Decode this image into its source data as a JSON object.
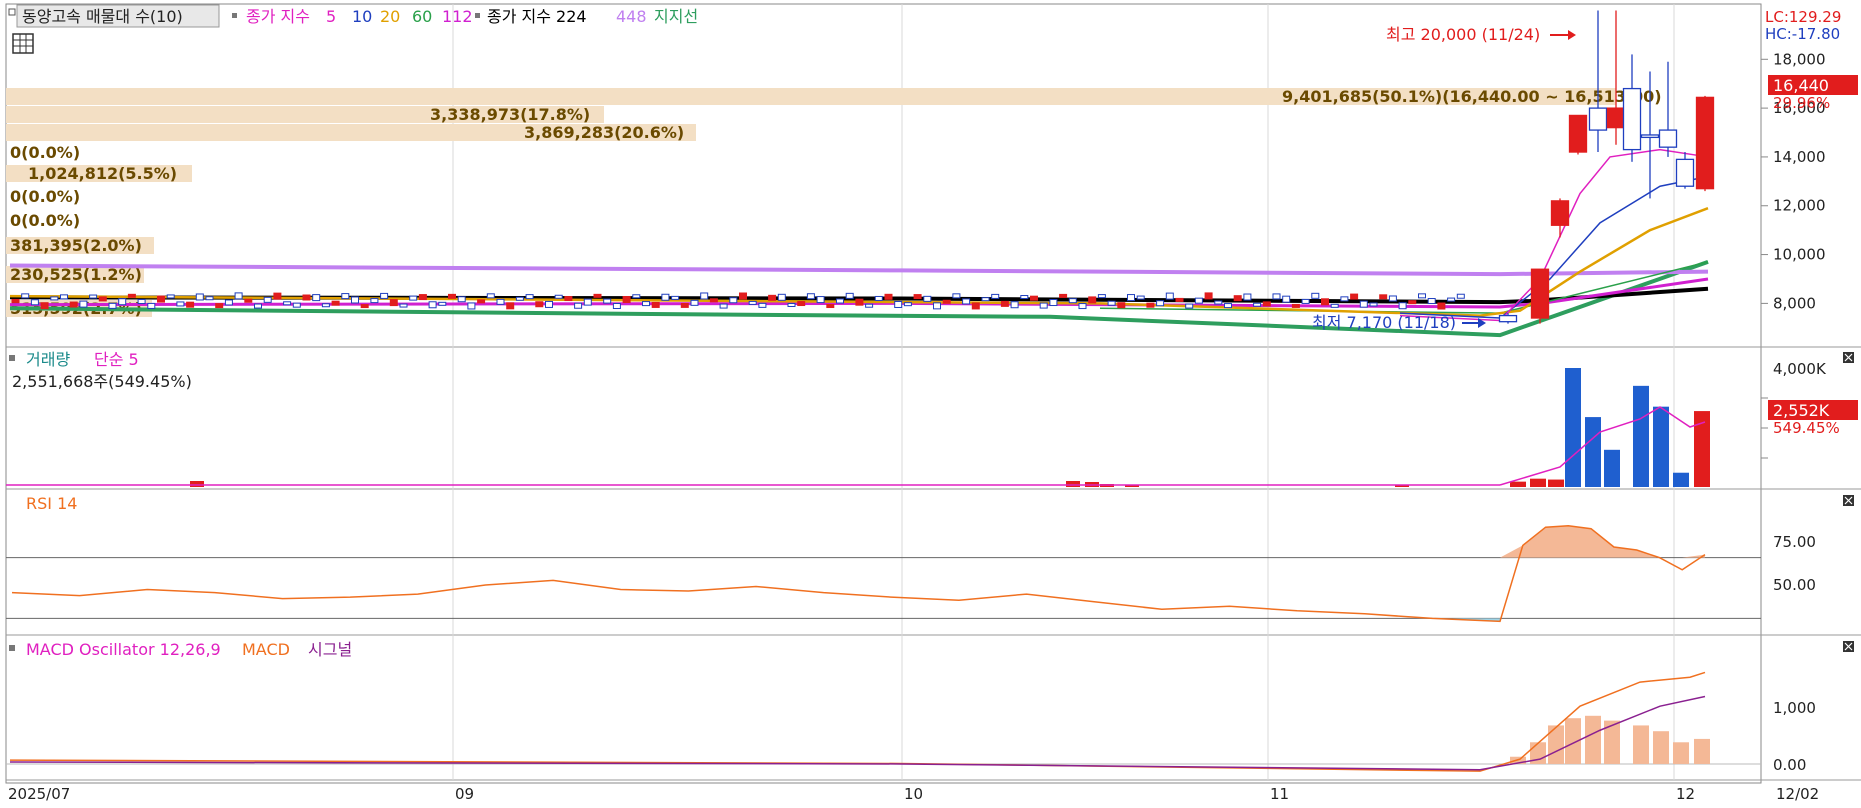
{
  "main_panel": {
    "legend": {
      "title": "동양고속 매물대 수(10)",
      "ma_label": "종가 지수",
      "ma_periods": [
        "5",
        "10",
        "20",
        "60",
        "112"
      ],
      "ma_colors": [
        "#e020c0",
        "#1f3fbf",
        "#e0a000",
        "#2aa04a",
        "#d020d0"
      ],
      "ma2_label": "종가 지수 224",
      "ma2_period2": "448",
      "ma2_colors": [
        "#000000",
        "#c080f0"
      ],
      "support_label": "지지선",
      "support_color": "#2e9e5e"
    },
    "lc": "LC:129.29",
    "hc": "HC:-17.80",
    "price_box": "16,440",
    "price_pct": "29.96%",
    "high_annotation": "최고 20,000 (11/24)",
    "low_annotation": "최저 7,170 (11/18)",
    "volume_profile_labels": [
      "9,401,685(50.1%)(16,440.00 ~ 16,513.00)",
      "3,338,973(17.8%)",
      "3,869,283(20.6%)",
      "0(0.0%)",
      "1,024,812(5.5%)",
      "0(0.0%)",
      "0(0.0%)",
      "381,395(2.0%)",
      "230,525(1.2%)",
      "515,592(2.7%)"
    ],
    "yticks": [
      "18,000",
      "16,000",
      "14,000",
      "12,000",
      "10,000",
      "8,000"
    ]
  },
  "volume_panel": {
    "legend_a": "거래량",
    "legend_b": "단순 5",
    "info": "2,551,668주(549.45%)",
    "ytick": "4,000K",
    "value_box": "2,552K",
    "value_pct": "549.45%"
  },
  "rsi_panel": {
    "legend": "RSI 14",
    "yticks": [
      "75.00",
      "50.00"
    ]
  },
  "macd_panel": {
    "legend_a": "MACD Oscillator 12,26,9",
    "legend_b": "MACD",
    "legend_c": "시그널",
    "yticks": [
      "1,000",
      "0.00"
    ]
  },
  "x_axis": {
    "labels": [
      "2025/07",
      "09",
      "10",
      "11",
      "12"
    ],
    "current_date": "12/02"
  },
  "chart_data": [
    {
      "type": "candlestick",
      "title": "동양고속",
      "ylim": [
        6500,
        19200
      ],
      "candles": [
        {
          "date": "2025/11/17",
          "open": 7500,
          "close": 7250,
          "high": 7600,
          "low": 7170
        },
        {
          "date": "2025/11/18",
          "open": 7400,
          "close": 9400,
          "high": 9400,
          "low": 7170
        },
        {
          "date": "2025/11/19",
          "open": 11200,
          "close": 12200,
          "high": 12300,
          "low": 10700
        },
        {
          "date": "2025/11/20",
          "open": 14200,
          "close": 15700,
          "high": 15700,
          "low": 14100
        },
        {
          "date": "2025/11/21",
          "open": 16000,
          "close": 15100,
          "high": 20000,
          "low": 14200
        },
        {
          "date": "2025/11/24",
          "open": 15200,
          "close": 16000,
          "high": 20000,
          "low": 14500
        },
        {
          "date": "2025/11/25",
          "open": 16800,
          "close": 14300,
          "high": 18200,
          "low": 13800
        },
        {
          "date": "2025/11/26",
          "open": 14900,
          "close": 14800,
          "high": 17500,
          "low": 12300
        },
        {
          "date": "2025/11/27",
          "open": 15100,
          "close": 14400,
          "high": 17900,
          "low": 14000
        },
        {
          "date": "2025/11/28",
          "open": 13900,
          "close": 12800,
          "high": 14200,
          "low": 12700
        },
        {
          "date": "2025/12/02",
          "open": 12700,
          "close": 16440,
          "high": 16500,
          "low": 12600
        }
      ],
      "base_range": [
        7800,
        8400
      ],
      "moving_averages": [
        {
          "name": "5",
          "end": 14000
        },
        {
          "name": "10",
          "end": 13200
        },
        {
          "name": "20",
          "end": 11900
        },
        {
          "name": "60",
          "end": 9700
        },
        {
          "name": "112",
          "end": 9000
        },
        {
          "name": "224",
          "end": 8600
        },
        {
          "name": "448",
          "end": 9300
        }
      ]
    },
    {
      "type": "bar",
      "title": "거래량",
      "ylim": [
        0,
        4000
      ],
      "unit": "K",
      "values": [
        180,
        280,
        250,
        4000,
        2350,
        1250,
        3400,
        2700,
        480,
        2552
      ],
      "up": [
        true,
        true,
        true,
        false,
        false,
        false,
        false,
        false,
        false,
        true
      ]
    },
    {
      "type": "line",
      "title": "RSI 14",
      "ylim": [
        25,
        100
      ],
      "hlines": [
        70,
        30
      ],
      "values": [
        47,
        45,
        49,
        47,
        43,
        44,
        46,
        52,
        55,
        49,
        48,
        51,
        47,
        44,
        42,
        46,
        41,
        36,
        38,
        35,
        33,
        30,
        28,
        78,
        90,
        91,
        89,
        77,
        75,
        70,
        62,
        72
      ]
    },
    {
      "type": "bar",
      "title": "MACD Oscillator 12,26,9",
      "ylim": [
        -250,
        2200
      ],
      "oscillator": [
        150,
        450,
        800,
        950,
        1000,
        900,
        800,
        680,
        450,
        520
      ],
      "macd_end": 1900,
      "signal_end": 1400
    }
  ]
}
